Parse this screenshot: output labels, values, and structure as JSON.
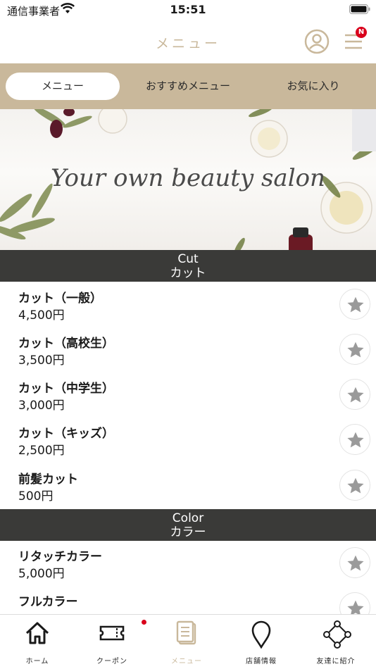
{
  "status_bar": {
    "carrier": "通信事業者",
    "time": "15:51"
  },
  "header": {
    "title": "メニュー",
    "badge": "N"
  },
  "tabs": [
    {
      "label": "メニュー",
      "active": true
    },
    {
      "label": "おすすめメニュー",
      "active": false
    },
    {
      "label": "お気に入り",
      "active": false
    }
  ],
  "banner": {
    "text": "Your own beauty salon"
  },
  "sections": [
    {
      "title_en": "Cut",
      "title_ja": "カット",
      "items": [
        {
          "name": "カット（一般）",
          "price": "4,500円"
        },
        {
          "name": "カット（高校生）",
          "price": "3,500円"
        },
        {
          "name": "カット（中学生）",
          "price": "3,000円"
        },
        {
          "name": "カット（キッズ）",
          "price": "2,500円"
        },
        {
          "name": "前髪カット",
          "price": "500円"
        }
      ]
    },
    {
      "title_en": "Color",
      "title_ja": "カラー",
      "items": [
        {
          "name": "リタッチカラー",
          "price": "5,000円"
        },
        {
          "name": "フルカラー",
          "price": ""
        }
      ]
    }
  ],
  "bottom_nav": [
    {
      "label": "ホーム",
      "icon": "home-icon",
      "active": false
    },
    {
      "label": "クーポン",
      "icon": "ticket-icon",
      "active": false
    },
    {
      "label": "メニュー",
      "icon": "document-icon",
      "active": true
    },
    {
      "label": "店舗情報",
      "icon": "map-pin-icon",
      "active": false
    },
    {
      "label": "友達に紹介",
      "icon": "share-icon",
      "active": false
    }
  ],
  "colors": {
    "accent": "#c9b89b",
    "section_bg": "#3a3a38",
    "badge": "#d9001b",
    "star": "#9a9a9a"
  }
}
